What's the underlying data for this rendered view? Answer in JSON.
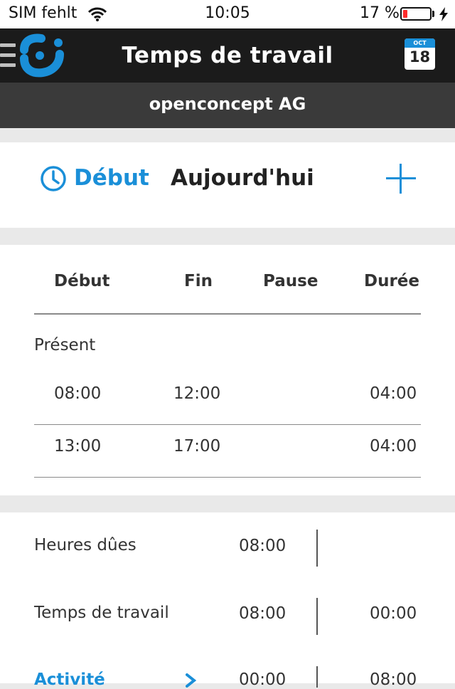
{
  "status_bar": {
    "carrier": "SIM fehlt",
    "time": "10:05",
    "battery_percent_label": "17 %",
    "battery_level": 0.17,
    "battery_color": "#ff2d2d"
  },
  "nav": {
    "title": "Temps de travail",
    "calendar_month": "OCT",
    "calendar_day": "18",
    "accent_color": "#1a8fd8"
  },
  "company": {
    "name": "openconcept AG"
  },
  "actions": {
    "start_label": "Début",
    "date_label": "Aujourd'hui"
  },
  "table": {
    "headers": {
      "start": "Début",
      "end": "Fin",
      "pause": "Pause",
      "duration": "Durée"
    },
    "section_label": "Présent",
    "rows": [
      {
        "start": "08:00",
        "end": "12:00",
        "pause": "",
        "duration": "04:00"
      },
      {
        "start": "13:00",
        "end": "17:00",
        "pause": "",
        "duration": "04:00"
      }
    ]
  },
  "summary": {
    "due_hours": {
      "label": "Heures dûes",
      "value": "08:00"
    },
    "work_time": {
      "label": "Temps de travail",
      "value": "08:00",
      "diff": "00:00"
    },
    "activity": {
      "label": "Activité",
      "value": "00:00",
      "diff": "08:00"
    }
  }
}
